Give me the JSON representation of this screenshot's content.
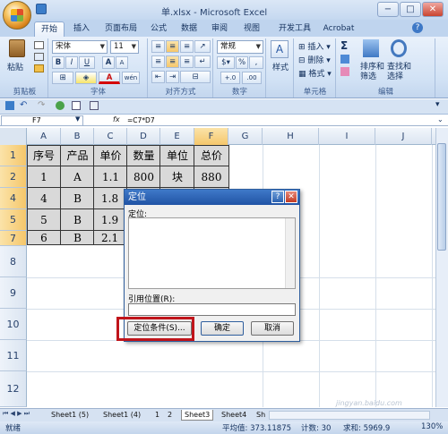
{
  "window": {
    "title": "单.xlsx - Microsoft Excel",
    "min": "−",
    "max": "□",
    "close": "✕"
  },
  "tabs": [
    "开始",
    "插入",
    "页面布局",
    "公式",
    "数据",
    "审阅",
    "视图",
    "开发工具",
    "Acrobat"
  ],
  "ribbon": {
    "paste": "粘贴",
    "clipboard_group": "剪贴板",
    "font_name": "宋体",
    "font_size": "11",
    "bold": "B",
    "italic": "I",
    "underline": "U",
    "grow_font": "A",
    "shrink_font": "A",
    "font_color_sample": "A",
    "wen": "wén",
    "font_group": "字体",
    "align_group": "对齐方式",
    "number_format": "常规",
    "percent": "%",
    "comma": ",",
    "dec_inc": "+.0",
    "dec_dec": ".00",
    "number_group": "数字",
    "styles": "样式",
    "insert": "插入",
    "delete": "删除",
    "format": "格式",
    "cells_group": "单元格",
    "sum": "Σ",
    "sort_filter": "排序和",
    "sort_filter2": "筛选",
    "find_select": "查找和",
    "find_select2": "选择",
    "editing_group": "编辑"
  },
  "name_box": "F7",
  "fx": "fx",
  "formula": "=C7*D7",
  "columns": [
    "A",
    "B",
    "C",
    "D",
    "E",
    "F",
    "G",
    "H",
    "I",
    "J"
  ],
  "rows": [
    "1",
    "2",
    "3",
    "4",
    "5",
    "6",
    "7",
    "8",
    "9",
    "10",
    "11",
    "12"
  ],
  "table": [
    [
      "序号",
      "产品",
      "单价",
      "数量",
      "单位",
      "总价"
    ],
    [
      "1",
      "A",
      "1.1",
      "800",
      "块",
      "880"
    ],
    [
      "4",
      "B",
      "1.8",
      "",
      "",
      ""
    ],
    [
      "5",
      "B",
      "1.9",
      "",
      "",
      ""
    ],
    [
      "6",
      "B",
      "2.1",
      "",
      "",
      ""
    ]
  ],
  "dialog": {
    "title": "定位",
    "help": "?",
    "close": "✕",
    "goto_label": "定位:",
    "ref_label": "引用位置(R):",
    "special_button": "定位条件(S)...",
    "ok_button": "确定",
    "cancel_button": "取消"
  },
  "sheets": [
    "Sheet1 (5)",
    "Sheet1 (4)",
    "1",
    "2",
    "Sheet3",
    "Sheet4",
    "Sh"
  ],
  "status": {
    "ready": "就绪",
    "average": "平均值: 373.11875",
    "count": "计数: 30",
    "sum": "求和: 5969.9",
    "zoom": "130%"
  },
  "watermark": "jingyan.baidu.com"
}
